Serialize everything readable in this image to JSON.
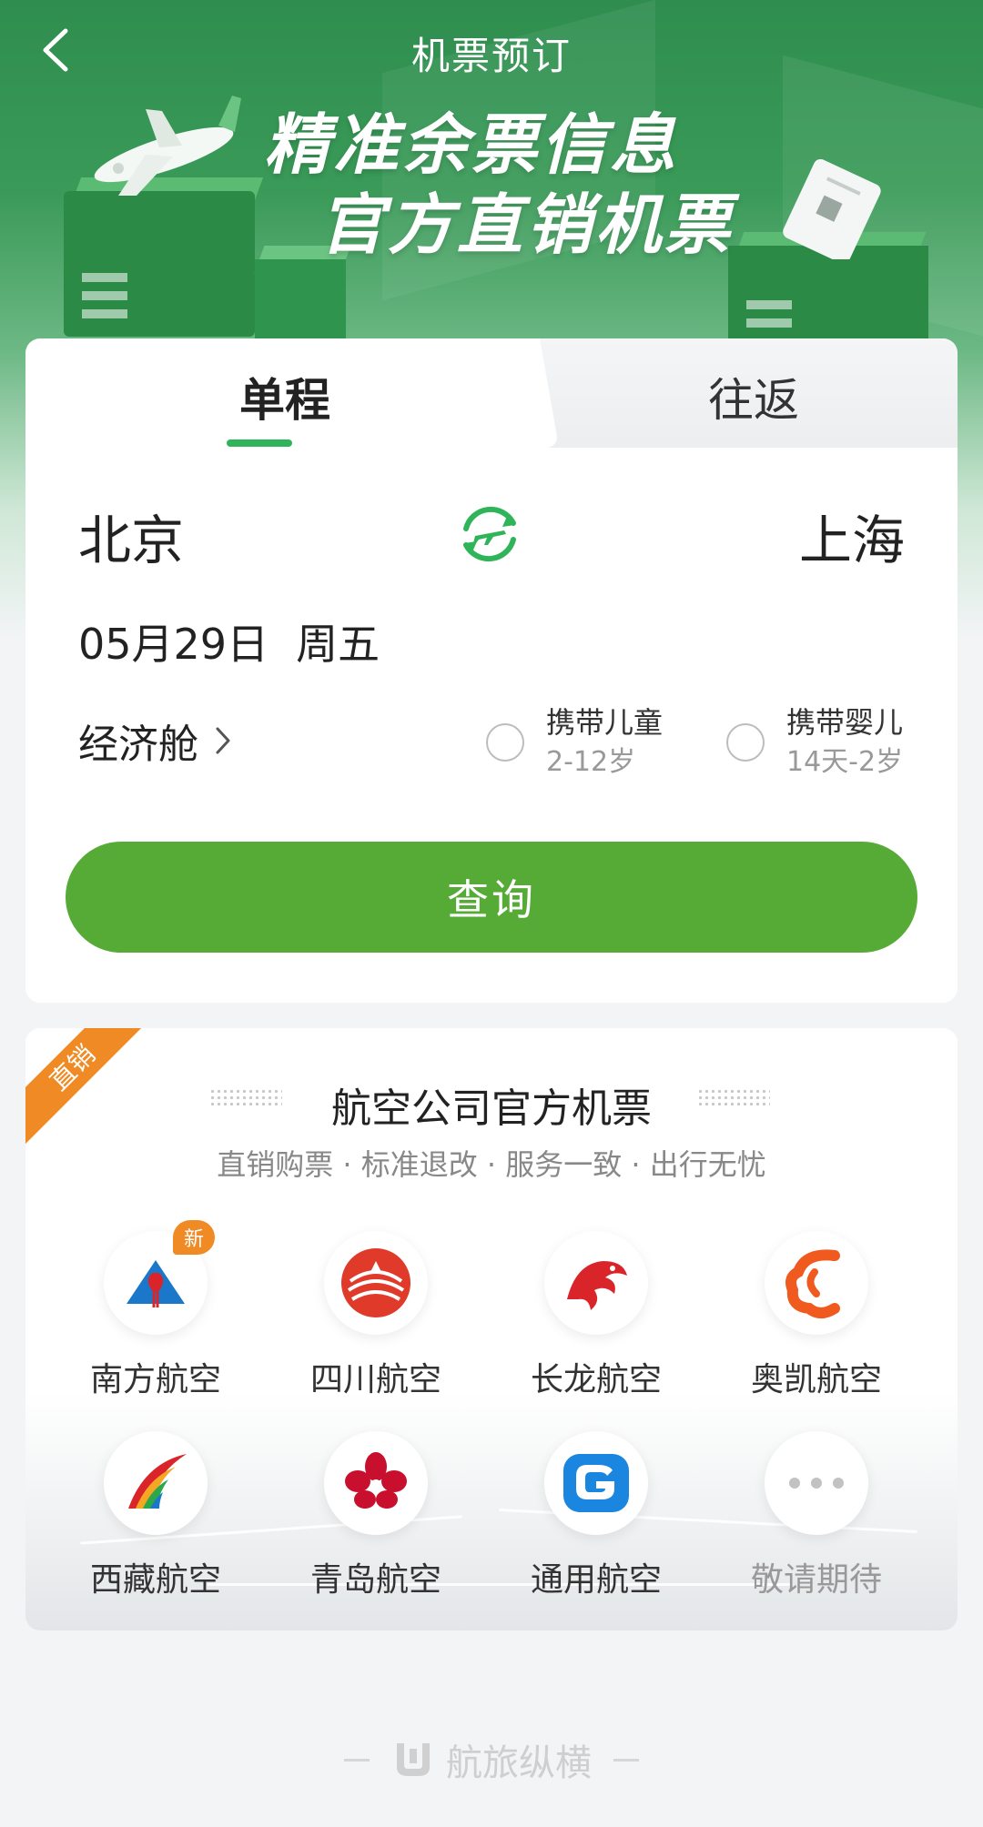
{
  "header": {
    "title": "机票预订",
    "slogan_line1": "精准余票信息",
    "slogan_line2": "官方直销机票"
  },
  "search": {
    "tabs": [
      {
        "label": "单程",
        "active": true
      },
      {
        "label": "往返",
        "active": false
      }
    ],
    "from_city": "北京",
    "to_city": "上海",
    "date": "05月29日",
    "weekday": "周五",
    "cabin": "经济舱",
    "options": [
      {
        "label": "携带儿童",
        "sub": "2-12岁",
        "checked": false
      },
      {
        "label": "携带婴儿",
        "sub": "14天-2岁",
        "checked": false
      }
    ],
    "query_label": "查询"
  },
  "airlines": {
    "ribbon": "直销",
    "title": "航空公司官方机票",
    "subtitle": "直销购票 · 标准退改 · 服务一致 · 出行无忧",
    "items": [
      {
        "name": "南方航空",
        "icon": "china-southern-icon",
        "badge": "新"
      },
      {
        "name": "四川航空",
        "icon": "sichuan-airlines-icon"
      },
      {
        "name": "长龙航空",
        "icon": "loong-air-icon"
      },
      {
        "name": "奥凯航空",
        "icon": "okay-airways-icon"
      },
      {
        "name": "西藏航空",
        "icon": "tibet-airlines-icon"
      },
      {
        "name": "青岛航空",
        "icon": "qingdao-airlines-icon"
      },
      {
        "name": "通用航空",
        "icon": "general-aviation-icon"
      },
      {
        "name": "敬请期待",
        "icon": "more-icon"
      }
    ]
  },
  "footer": {
    "brand": "航旅纵横"
  },
  "colors": {
    "brand_green": "#2fb45a",
    "button_green": "#56ab37",
    "accent_orange": "#f08a24"
  }
}
